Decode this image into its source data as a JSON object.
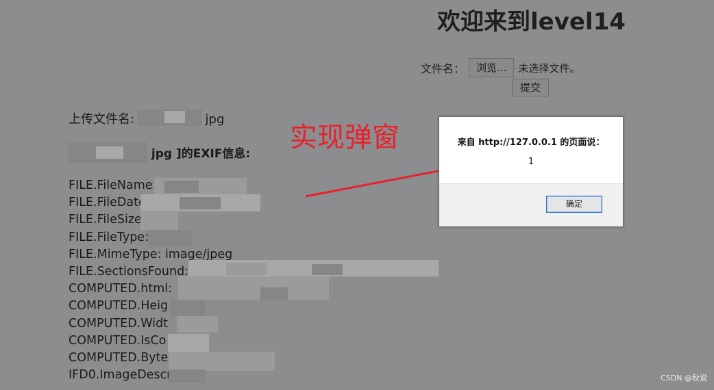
{
  "page": {
    "title": "欢迎来到level14"
  },
  "upload": {
    "label": "文件名：",
    "browse_button": "浏览...",
    "no_file_text": "未选择文件。",
    "submit_button": "提交"
  },
  "result": {
    "uploaded_prefix": "上传文件名:",
    "uploaded_suffix": "jpg",
    "exif_heading": "jpg ]的EXIF信息:",
    "exif_fields": [
      "FILE.FileName:",
      "FILE.FileDate",
      "FILE.FileSize",
      "FILE.FileType:",
      "FILE.MimeType: image/jpeg",
      "FILE.SectionsFound:",
      "COMPUTED.html:",
      "COMPUTED.Heig",
      "COMPUTED.Widt",
      "COMPUTED.IsCo",
      "COMPUTED.Byte",
      "IFD0.ImageDescr"
    ]
  },
  "annotation": {
    "text": "实现弹窗",
    "color": "#e8212e"
  },
  "dialog": {
    "title": "来自 http://127.0.0.1 的页面说：",
    "message": "1",
    "ok_button": "确定"
  },
  "watermark": "CSDN @秋说",
  "colors": {
    "overlay_background": "#8c8d8f",
    "dialog_background": "#ffffff",
    "dialog_footer": "#f0f0f0",
    "ok_button_border": "#2e74d6"
  },
  "icons": [
    "red-arrow-icon"
  ]
}
